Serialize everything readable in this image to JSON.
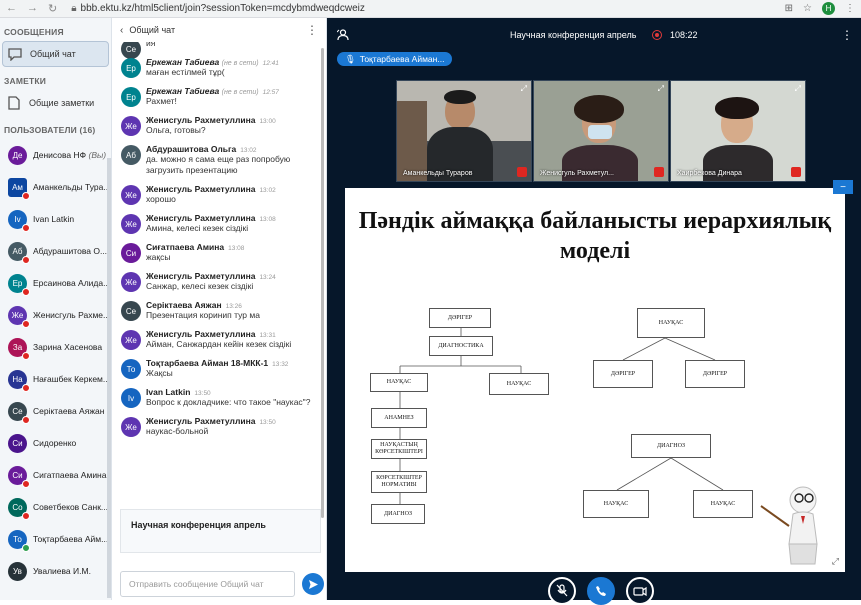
{
  "browser": {
    "url": "bbb.ektu.kz/html5client/join?sessionToken=mcdybmdweqdcweiz",
    "profile_initial": "Н"
  },
  "sidebar": {
    "messages_head": "СООБЩЕНИЯ",
    "public_chat": "Общий чат",
    "notes_head": "ЗАМЕТКИ",
    "shared_notes": "Общие заметки",
    "users_head": "ПОЛЬЗОВАТЕЛИ (16)",
    "users": [
      {
        "initials": "Де",
        "name": "Денисова НФ",
        "suffix": "(Вы)",
        "color": "#6a1b9a",
        "square": false,
        "mic": "none"
      },
      {
        "initials": "Ам",
        "name": "Аманкельды Тура...",
        "suffix": "",
        "color": "#0d47a1",
        "square": true,
        "mic": "red"
      },
      {
        "initials": "Iv",
        "name": "Ivan Latkin",
        "suffix": "",
        "color": "#1565c0",
        "square": false,
        "mic": "red"
      },
      {
        "initials": "Аб",
        "name": "Абдурашитова О...",
        "suffix": "",
        "color": "#455a64",
        "square": false,
        "mic": "red"
      },
      {
        "initials": "Ер",
        "name": "Ерсаинова Алида...",
        "suffix": "",
        "color": "#00838f",
        "square": false,
        "mic": "red"
      },
      {
        "initials": "Же",
        "name": "Женисгуль Рахме...",
        "suffix": "",
        "color": "#5e35b1",
        "square": false,
        "mic": "red"
      },
      {
        "initials": "За",
        "name": "Зарина Хасенова",
        "suffix": "",
        "color": "#ad1457",
        "square": false,
        "mic": "red"
      },
      {
        "initials": "На",
        "name": "Нағашбек Керкем...",
        "suffix": "",
        "color": "#283593",
        "square": false,
        "mic": "red"
      },
      {
        "initials": "Се",
        "name": "Серіктаева Аяжан",
        "suffix": "",
        "color": "#37474f",
        "square": false,
        "mic": "red"
      },
      {
        "initials": "Си",
        "name": "Сидоренко",
        "suffix": "",
        "color": "#4a148c",
        "square": false,
        "mic": "none"
      },
      {
        "initials": "Си",
        "name": "Сигатпаева Амина",
        "suffix": "",
        "color": "#6a1b9a",
        "square": false,
        "mic": "red"
      },
      {
        "initials": "Со",
        "name": "Советбеков Санк...",
        "suffix": "",
        "color": "#00695c",
        "square": false,
        "mic": "red"
      },
      {
        "initials": "То",
        "name": "Тоқтарбаева Айм...",
        "suffix": "",
        "color": "#1565c0",
        "square": false,
        "mic": "green"
      },
      {
        "initials": "Ув",
        "name": "Увалиева И.М.",
        "suffix": "",
        "color": "#263238",
        "square": false,
        "mic": "none"
      }
    ]
  },
  "chat": {
    "back_title": "Общий чат",
    "messages": [
      {
        "initials": "Се",
        "color": "#37474f",
        "name": "",
        "status": "",
        "time": "",
        "text": "ия"
      },
      {
        "initials": "Ер",
        "color": "#00838f",
        "name": "Еркежан Табиева",
        "status": "(не в сети)",
        "time": "12:41",
        "text": "маған естілмей тұр(",
        "offline": true
      },
      {
        "initials": "Ер",
        "color": "#00838f",
        "name": "Еркежан Табиева",
        "status": "(не в сети)",
        "time": "12:57",
        "text": "Рахмет!",
        "offline": true
      },
      {
        "initials": "Же",
        "color": "#5e35b1",
        "name": "Женисгуль Рахметуллина",
        "status": "",
        "time": "13:00",
        "text": "Ольга, готовы?"
      },
      {
        "initials": "Аб",
        "color": "#455a64",
        "name": "Абдурашитова Ольга",
        "status": "",
        "time": "13:02",
        "text": "да. можно я сама еще раз попробую загрузить презентацию"
      },
      {
        "initials": "Же",
        "color": "#5e35b1",
        "name": "Женисгуль Рахметуллина",
        "status": "",
        "time": "13:02",
        "text": "хорошо"
      },
      {
        "initials": "Же",
        "color": "#5e35b1",
        "name": "Женисгуль Рахметуллина",
        "status": "",
        "time": "13:08",
        "text": "Амина, келесі кезек сіздікі"
      },
      {
        "initials": "Си",
        "color": "#6a1b9a",
        "name": "Сиғатпаева Амина",
        "status": "",
        "time": "13:08",
        "text": "жақсы"
      },
      {
        "initials": "Же",
        "color": "#5e35b1",
        "name": "Женисгуль Рахметуллина",
        "status": "",
        "time": "13:24",
        "text": "Санжар, келесі кезек сіздікі"
      },
      {
        "initials": "Се",
        "color": "#37474f",
        "name": "Серіктаева Аяжан",
        "status": "",
        "time": "13:26",
        "text": "Презентация коринип тур ма"
      },
      {
        "initials": "Же",
        "color": "#5e35b1",
        "name": "Женисгуль Рахметуллина",
        "status": "",
        "time": "13:31",
        "text": "Айман, Санжардан кейін кезек сіздікі"
      },
      {
        "initials": "То",
        "color": "#1565c0",
        "name": "Тоқтарбаева Айман 18-МКК-1",
        "status": "",
        "time": "13:32",
        "text": "Жақсы"
      },
      {
        "initials": "Iv",
        "color": "#1565c0",
        "name": "Ivan Latkin",
        "status": "",
        "time": "13:50",
        "text": "Вопрос к докладчике: что такое \"наукас\"?"
      },
      {
        "initials": "Же",
        "color": "#5e35b1",
        "name": "Женисгуль Рахметуллина",
        "status": "",
        "time": "13:50",
        "text": "наукас-больной"
      }
    ],
    "poll_title": "Научная конференция апрель",
    "input_placeholder": "Отправить сообщение Общий чат"
  },
  "meeting": {
    "title": "Научная конференция апрель",
    "timer": "108:22",
    "talking": "Тоқтарбаева Айман...",
    "videos": [
      {
        "name": "Аманкельды Тураров"
      },
      {
        "name": "Женисгуль Рахметул..."
      },
      {
        "name": "Хаирбекова Динара"
      }
    ]
  },
  "slide": {
    "title_line1": "Пәндік аймаққа байланысты иерархиялық",
    "title_line2": "моделі",
    "nodes": {
      "a_doctor": "ДӘРІГЕР",
      "a_diag": "ДИАГНОСТИКА",
      "a_patient": "НАУҚАС",
      "a_patient2": "НАУҚАС",
      "a_anamnez": "АНАМНЕЗ",
      "a_indicators": "НАУҚАСТЫҢ КӨРСЕТКІШТЕРІ",
      "a_norm": "КӨРСЕТКІШТЕР НОРМАТИВІ",
      "a_diagnoz": "ДИАГНОЗ",
      "b_patient": "НАУҚАС",
      "b_doc1": "ДӘРІГЕР",
      "b_doc2": "ДӘРІГЕР",
      "c_diagnoz": "ДИАГНОЗ",
      "c_patient1": "НАУҚАС",
      "c_patient2": "НАУҚАС"
    }
  }
}
